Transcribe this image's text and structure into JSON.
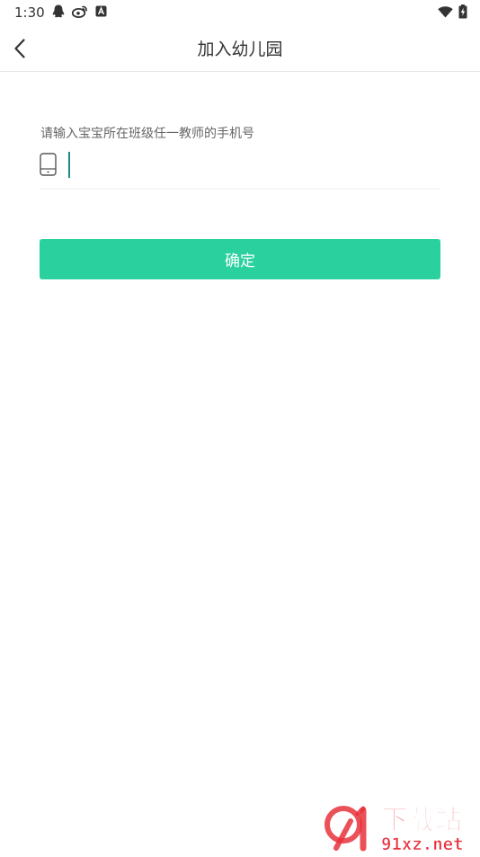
{
  "status_bar": {
    "time": "1:30"
  },
  "header": {
    "title": "加入幼儿园"
  },
  "form": {
    "hint": "请输入宝宝所在班级任一教师的手机号",
    "phone_value": "",
    "phone_placeholder": ""
  },
  "actions": {
    "confirm_label": "确定"
  },
  "watermark": {
    "text_top": "下载站",
    "text_bottom": "91xz.net"
  },
  "colors": {
    "accent": "#2ad19e",
    "caret": "#1f8a86",
    "watermark_red": "#e8323c"
  }
}
